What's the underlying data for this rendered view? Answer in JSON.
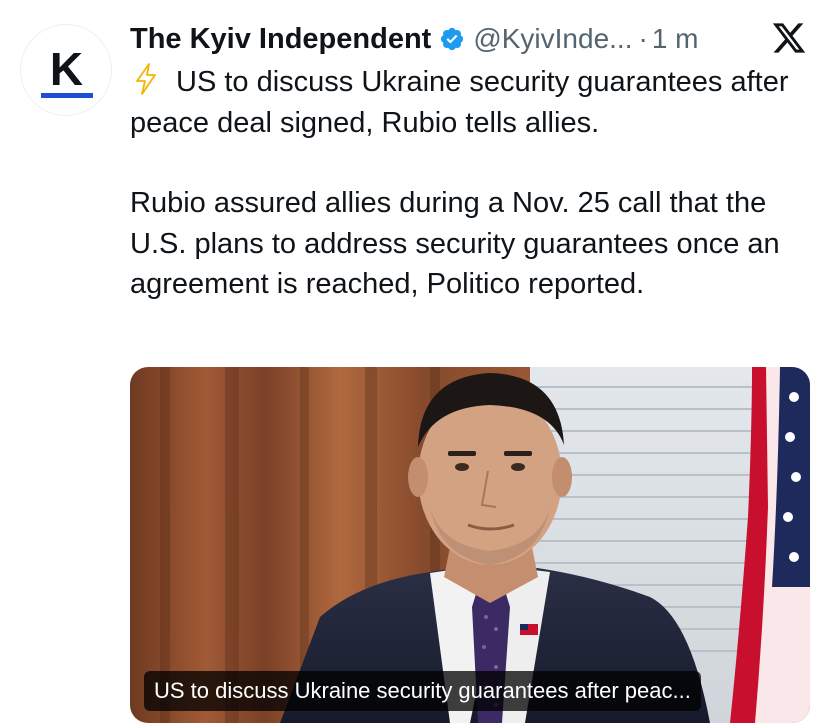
{
  "author": {
    "display_name": "The Kyiv Independent",
    "handle": "@KyivInde...",
    "separator": "·",
    "time": "1 m",
    "avatar_letter": "K",
    "verified_color": "#1d9bf0"
  },
  "icons": {
    "verified": "verified-badge-icon",
    "x_logo": "x-logo-icon",
    "bolt": "lightning-bolt-emoji"
  },
  "tweet": {
    "headline": "US to discuss Ukraine security guarantees after peace deal signed, Rubio tells allies.",
    "body": "Rubio assured allies during a Nov. 25 call that the U.S. plans to address security guarantees once an agreement is reached, Politico reported."
  },
  "card": {
    "caption": "US to discuss Ukraine security guarantees after peac..."
  }
}
